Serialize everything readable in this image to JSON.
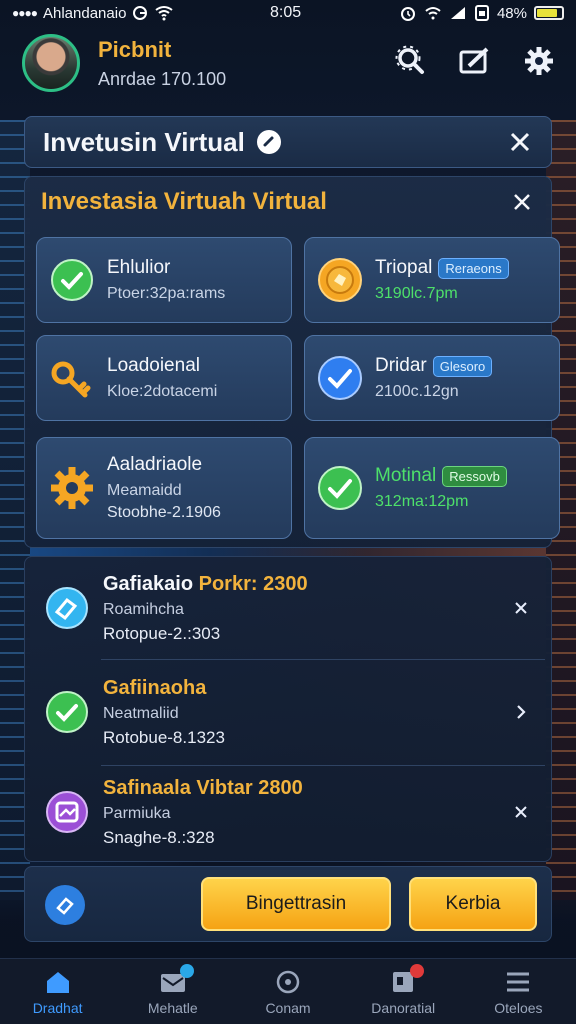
{
  "status_bar": {
    "carrier": "Ahlandanaio",
    "time": "8:05",
    "battery_percent": "48%",
    "battery_level": 0.85
  },
  "profile": {
    "name": "Picbnit",
    "subtitle": "Anrdae 170.100"
  },
  "panel_top": {
    "title": "Invetusin Virtual"
  },
  "panel_main": {
    "title": "Investasia Virtuah Virtual",
    "cards": [
      {
        "title": "Ehlulior",
        "line2": "Ptoer:32pa:rams",
        "line3": "",
        "icon": "check-circle-icon"
      },
      {
        "title": "Triopal",
        "tag": "Reraeons",
        "line2": "3190lc.7pm",
        "icon": "coin-icon"
      },
      {
        "title": "Loadoienal",
        "line2": "Kloe:2dotacemi",
        "line3": "",
        "icon": "key-icon"
      },
      {
        "title": "Dridar",
        "tag": "Glesoro",
        "line2": "2100c.12gn",
        "icon": "check-circle-icon"
      },
      {
        "title": "Aaladriaole",
        "line2": "Meamaidd",
        "line3": "Stoobhe-2.1906",
        "icon": "gear-icon"
      },
      {
        "title": "Motinal",
        "tag": "Ressovb",
        "line2": "312ma:12pm",
        "icon": "check-circle-icon"
      }
    ]
  },
  "list": {
    "items": [
      {
        "title": "Gafiakaio",
        "title_accent": "Porkr: 2300",
        "line2": "Roamihcha",
        "line3": "Rotopue-2.:303",
        "action": "close-icon",
        "icon": "ticket-icon"
      },
      {
        "title": "Gafiinaoha",
        "title_accent": "",
        "line2": "Neatmaliid",
        "line3": "Rotobue-8.1323",
        "action": "chevron-right-icon",
        "icon": "check-circle-icon"
      },
      {
        "title": "Safinaala Vibtar 2800",
        "title_accent": "",
        "line2": "Parmiuka",
        "line3": "Snaghe-8.:328",
        "action": "close-icon",
        "icon": "ticket-icon"
      }
    ]
  },
  "actions": {
    "primary": "Bingettrasin",
    "secondary": "Kerbia"
  },
  "nav": {
    "items": [
      "Dradhat",
      "Mehatle",
      "Conam",
      "Danoratial",
      "Oteloes"
    ]
  },
  "colors": {
    "accent_gold": "#f2b33d",
    "accent_blue": "#3f9bff",
    "green": "#4ee06a"
  }
}
